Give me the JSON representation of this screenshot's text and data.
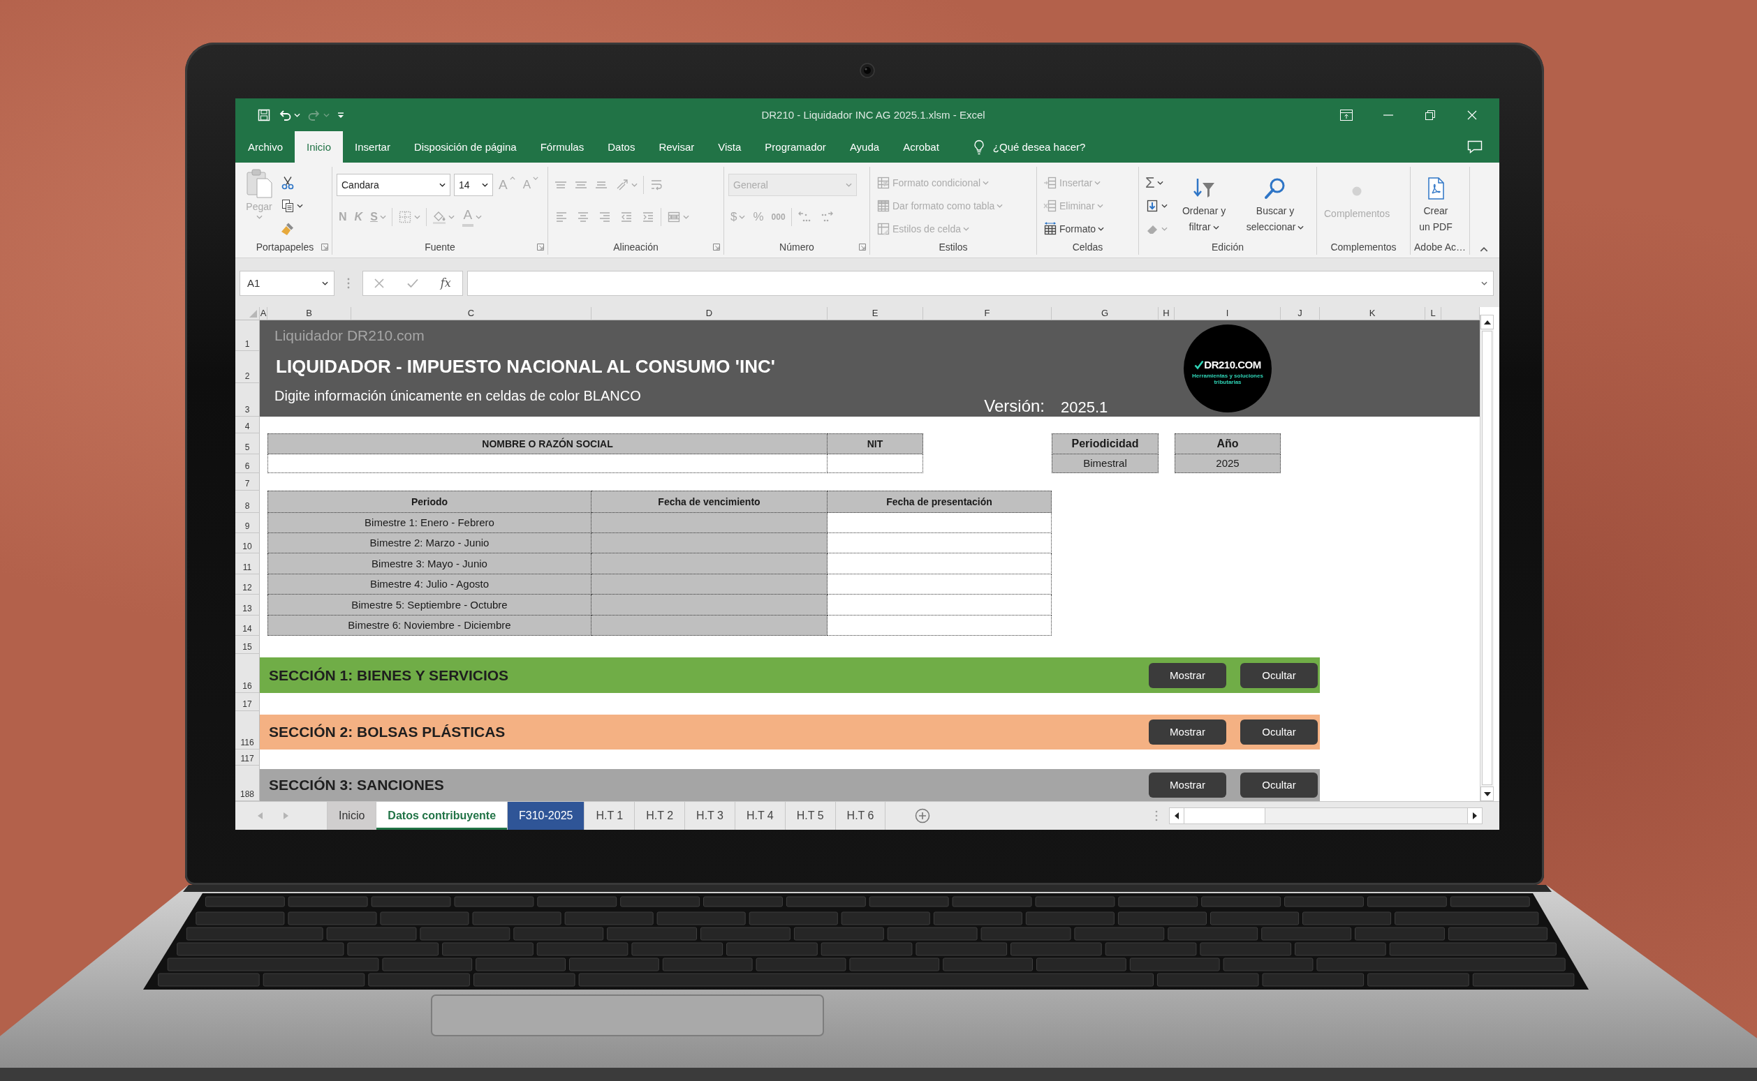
{
  "window": {
    "title": "DR210 - Liquidador INC AG 2025.1.xlsm - Excel"
  },
  "quick_access": [
    {
      "disabled": false,
      "dropdown": false
    },
    {
      "disabled": false,
      "dropdown": true
    },
    {
      "disabled": true,
      "dropdown": true
    },
    {
      "disabled": false,
      "dropdown": false
    }
  ],
  "ribbon_tabs": [
    {
      "label": "Archivo",
      "selected": false
    },
    {
      "label": "Inicio",
      "selected": true
    },
    {
      "label": "Insertar",
      "selected": false
    },
    {
      "label": "Disposición de página",
      "selected": false
    },
    {
      "label": "Fórmulas",
      "selected": false
    },
    {
      "label": "Datos",
      "selected": false
    },
    {
      "label": "Revisar",
      "selected": false
    },
    {
      "label": "Vista",
      "selected": false
    },
    {
      "label": "Programador",
      "selected": false
    },
    {
      "label": "Ayuda",
      "selected": false
    },
    {
      "label": "Acrobat",
      "selected": false
    }
  ],
  "tell_me": "¿Qué desea hacer?",
  "ribbon": [
    {
      "label": "Portapapeles",
      "launcher": true,
      "sections": [
        {
          "kind": "large",
          "commands": [
            {
              "kind": "button",
              "label": "Pegar",
              "disabled": true,
              "dropdown": true
            }
          ]
        },
        {
          "kind": "stack",
          "commands": [
            {
              "kind": "button",
              "disabled": false,
              "dropdown": false
            },
            {
              "kind": "button",
              "disabled": false,
              "dropdown": true
            },
            {
              "kind": "button",
              "disabled": false,
              "dropdown": false
            }
          ]
        }
      ]
    },
    {
      "label": "Fuente",
      "launcher": true,
      "sections": [
        {
          "kind": "two_line",
          "top": [
            {
              "kind": "combo",
              "value": "Candara",
              "disabled": false
            },
            {
              "kind": "combo",
              "value": "14",
              "disabled": false
            },
            {
              "kind": "button",
              "label": "A",
              "disabled": true,
              "dropdown": false
            },
            {
              "kind": "button",
              "label": "A",
              "disabled": true,
              "dropdown": false
            }
          ],
          "bottom": [
            {
              "kind": "button",
              "label": "N",
              "disabled": true,
              "dropdown": false
            },
            {
              "kind": "button",
              "label": "K",
              "disabled": true,
              "dropdown": false
            },
            {
              "kind": "button",
              "label": "S",
              "disabled": true,
              "dropdown": true
            },
            {
              "kind": "button",
              "disabled": true,
              "dropdown": true
            },
            {
              "kind": "button",
              "disabled": true,
              "dropdown": true
            },
            {
              "kind": "button",
              "label": "A",
              "disabled": true,
              "dropdown": true
            }
          ]
        }
      ]
    },
    {
      "label": "Alineación",
      "launcher": true,
      "sections": [
        {
          "kind": "two_line",
          "top": [
            {
              "kind": "button",
              "disabled": true,
              "dropdown": false
            },
            {
              "kind": "button",
              "disabled": true,
              "dropdown": false
            },
            {
              "kind": "button",
              "disabled": true,
              "dropdown": false
            },
            {
              "kind": "button",
              "disabled": true,
              "dropdown": true
            },
            {
              "kind": "button",
              "disabled": true,
              "dropdown": false
            }
          ],
          "bottom": [
            {
              "kind": "button",
              "disabled": true,
              "dropdown": false
            },
            {
              "kind": "button",
              "disabled": true,
              "dropdown": false
            },
            {
              "kind": "button",
              "disabled": true,
              "dropdown": false
            },
            {
              "kind": "button",
              "disabled": true,
              "dropdown": false
            },
            {
              "kind": "button",
              "disabled": true,
              "dropdown": false
            },
            {
              "kind": "button",
              "disabled": true,
              "dropdown": true
            }
          ]
        }
      ]
    },
    {
      "label": "Número",
      "launcher": true,
      "sections": [
        {
          "kind": "two_line",
          "top": [
            {
              "kind": "combo",
              "value": "General",
              "disabled": true
            }
          ],
          "bottom": [
            {
              "kind": "button",
              "label": "$",
              "disabled": true,
              "dropdown": true
            },
            {
              "kind": "button",
              "label": "%",
              "disabled": true,
              "dropdown": false
            },
            {
              "kind": "button",
              "label": "000",
              "disabled": true,
              "dropdown": false
            },
            {
              "kind": "button",
              "disabled": true,
              "dropdown": false
            },
            {
              "kind": "button",
              "disabled": true,
              "dropdown": false
            }
          ]
        }
      ]
    },
    {
      "label": "Estilos",
      "launcher": false,
      "sections": [
        {
          "kind": "stack",
          "commands": [
            {
              "kind": "button",
              "label": "Formato condicional",
              "disabled": true,
              "dropdown": true
            },
            {
              "kind": "button",
              "label": "Dar formato como tabla",
              "disabled": true,
              "dropdown": true
            },
            {
              "kind": "button",
              "label": "Estilos de celda",
              "disabled": true,
              "dropdown": true
            }
          ]
        }
      ]
    },
    {
      "label": "Celdas",
      "launcher": false,
      "sections": [
        {
          "kind": "stack",
          "commands": [
            {
              "kind": "button",
              "label": "Insertar",
              "disabled": true,
              "dropdown": true
            },
            {
              "kind": "button",
              "label": "Eliminar",
              "disabled": true,
              "dropdown": true
            },
            {
              "kind": "button",
              "label": "Formato",
              "disabled": false,
              "dropdown": true
            }
          ]
        }
      ]
    },
    {
      "label": "Edición",
      "launcher": false,
      "sections": [
        {
          "kind": "stack",
          "commands": [
            {
              "kind": "button",
              "label": "Σ",
              "disabled": false,
              "dropdown": true
            },
            {
              "kind": "button",
              "disabled": false,
              "dropdown": true
            },
            {
              "kind": "button",
              "disabled": true,
              "dropdown": true
            }
          ]
        },
        {
          "kind": "large",
          "commands": [
            {
              "kind": "button",
              "label": "Ordenar y filtrar",
              "disabled": false,
              "dropdown": true
            }
          ]
        },
        {
          "kind": "large",
          "commands": [
            {
              "kind": "button",
              "label": "Buscar y seleccionar",
              "disabled": false,
              "dropdown": true
            }
          ]
        }
      ]
    },
    {
      "label": "Complementos",
      "launcher": false,
      "sections": [
        {
          "kind": "large",
          "commands": [
            {
              "kind": "button",
              "label": "Complementos",
              "disabled": true,
              "dropdown": false
            }
          ]
        }
      ]
    },
    {
      "label": "Adobe Ac…",
      "launcher": false,
      "sections": [
        {
          "kind": "large",
          "commands": [
            {
              "kind": "button",
              "label": "Crear un PDF",
              "disabled": false,
              "dropdown": false
            }
          ]
        }
      ]
    }
  ],
  "formula_bar": {
    "name_box": "A1",
    "function_label": "fx"
  },
  "sheet": {
    "column_headers": [
      "A",
      "B",
      "C",
      "D",
      "E",
      "F",
      "G",
      "H",
      "I",
      "J",
      "K",
      "L"
    ],
    "row_headers": [
      "1",
      "2",
      "3",
      "4",
      "5",
      "6",
      "7",
      "8",
      "9",
      "10",
      "11",
      "12",
      "13",
      "14",
      "15",
      "16",
      "17",
      "116",
      "117",
      "188"
    ],
    "banner": {
      "brand": "Liquidador DR210.com",
      "title": "LIQUIDADOR - IMPUESTO NACIONAL AL CONSUMO 'INC'",
      "subtitle": "Digite información únicamente en celdas de color BLANCO",
      "version_label": "Versión:",
      "version": "2025.1",
      "logo": {
        "name": "DR210.COM",
        "tagline": "Herramientas y soluciones tributarias"
      }
    },
    "taxpayer": {
      "columns": [
        "NOMBRE O RAZÓN SOCIAL",
        "NIT"
      ]
    },
    "periodicity": {
      "label": "Periodicidad",
      "value": "Bimestral"
    },
    "year": {
      "label": "Año",
      "value": "2025"
    },
    "periods": {
      "columns": [
        "Periodo",
        "Fecha de vencimiento",
        "Fecha de presentación"
      ],
      "rows": [
        "Bimestre 1: Enero - Febrero",
        "Bimestre 2: Marzo - Junio",
        "Bimestre 3: Mayo - Junio",
        "Bimestre 4: Julio - Agosto",
        "Bimestre 5: Septiembre - Octubre",
        "Bimestre 6: Noviembre - Diciembre"
      ]
    },
    "sections": [
      {
        "title": "SECCIÓN 1: BIENES Y SERVICIOS",
        "color": "#70ad47",
        "buttons": [
          "Mostrar",
          "Ocultar"
        ]
      },
      {
        "title": "SECCIÓN 2: BOLSAS PLÁSTICAS",
        "color": "#f4b183",
        "buttons": [
          "Mostrar",
          "Ocultar"
        ]
      },
      {
        "title": "SECCIÓN 3: SANCIONES",
        "color": "#a5a5a5",
        "buttons": [
          "Mostrar",
          "Ocultar"
        ]
      }
    ]
  },
  "sheet_tabs": [
    {
      "label": "Inicio",
      "selected": false,
      "color": "#d0cece"
    },
    {
      "label": "Datos contribuyente",
      "selected": true
    },
    {
      "label": "F310-2025",
      "selected": false,
      "color": "#2f5597"
    },
    {
      "label": "H.T 1",
      "selected": false
    },
    {
      "label": "H.T 2",
      "selected": false
    },
    {
      "label": "H.T 3",
      "selected": false
    },
    {
      "label": "H.T 4",
      "selected": false
    },
    {
      "label": "H.T 5",
      "selected": false
    },
    {
      "label": "H.T 6",
      "selected": false
    }
  ]
}
